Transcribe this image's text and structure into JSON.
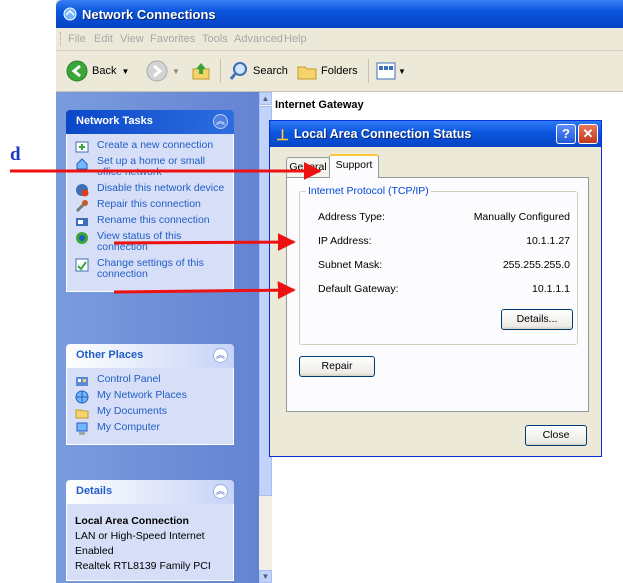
{
  "window": {
    "title": "Network Connections"
  },
  "menu": [
    "File",
    "Edit",
    "View",
    "Favorites",
    "Tools",
    "Advanced",
    "Help"
  ],
  "toolbar": {
    "back": "Back",
    "search": "Search",
    "folders": "Folders"
  },
  "network_tasks": {
    "title": "Network Tasks",
    "items": [
      {
        "label": "Create a new connection",
        "icon": "new-connection-icon"
      },
      {
        "label": "Set up a home or small office network",
        "icon": "home-network-icon"
      },
      {
        "label": "Disable this network device",
        "icon": "disable-device-icon"
      },
      {
        "label": "Repair this connection",
        "icon": "repair-icon"
      },
      {
        "label": "Rename this connection",
        "icon": "rename-icon"
      },
      {
        "label": "View status of this connection",
        "icon": "status-icon"
      },
      {
        "label": "Change settings of this connection",
        "icon": "settings-icon"
      }
    ]
  },
  "other_places": {
    "title": "Other Places",
    "items": [
      {
        "label": "Control Panel",
        "icon": "control-panel-icon"
      },
      {
        "label": "My Network Places",
        "icon": "network-places-icon"
      },
      {
        "label": "My Documents",
        "icon": "documents-folder-icon"
      },
      {
        "label": "My Computer",
        "icon": "computer-icon"
      }
    ]
  },
  "details": {
    "title": "Details",
    "name": "Local Area Connection",
    "lines": [
      "LAN or High-Speed Internet",
      "Enabled",
      "Realtek RTL8139 Family PCI"
    ]
  },
  "content": {
    "header": "Internet Gateway"
  },
  "dialog": {
    "title": "Local Area Connection Status",
    "tabs": [
      "General",
      "Support"
    ],
    "group_title": "Internet Protocol (TCP/IP)",
    "rows": [
      {
        "label": "Address Type:",
        "value": "Manually Configured"
      },
      {
        "label": "IP Address:",
        "value": "10.1.1.27"
      },
      {
        "label": "Subnet Mask:",
        "value": "255.255.255.0"
      },
      {
        "label": "Default Gateway:",
        "value": "10.1.1.1"
      }
    ],
    "details_button": "Details...",
    "repair_button": "Repair",
    "close_button": "Close"
  },
  "annotation": {
    "letter": "d",
    "color": "#ee1111"
  },
  "colors": {
    "xp_blue": "#0a55dd",
    "task_link": "#215dc6",
    "pane_blue": "#7a9cde"
  }
}
